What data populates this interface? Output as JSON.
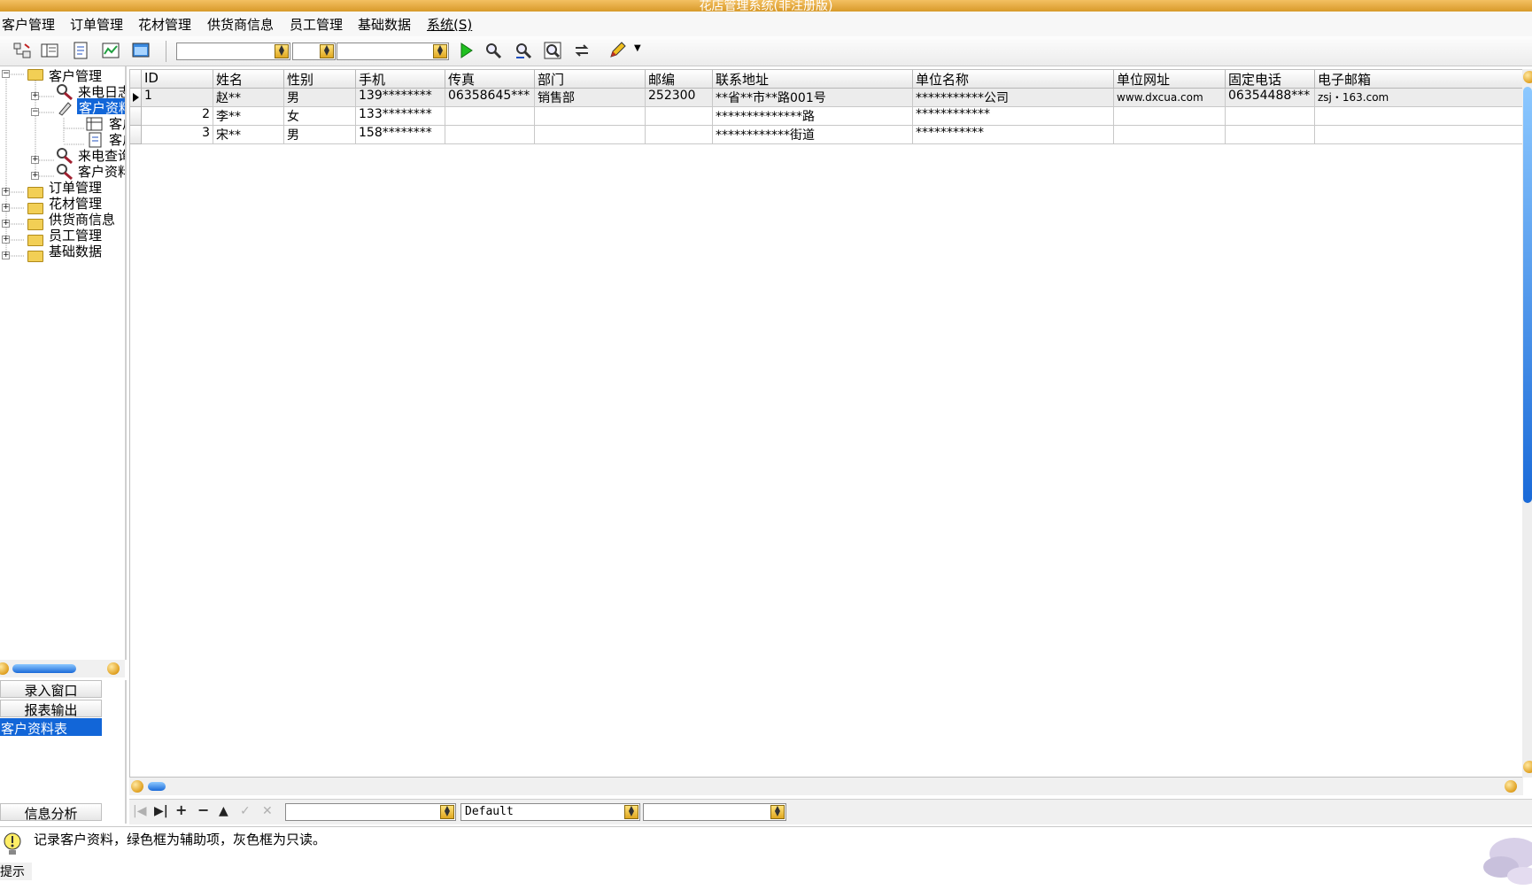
{
  "window": {
    "title": "花店管理系统(非注册版)"
  },
  "menu": [
    {
      "label": "客户管理"
    },
    {
      "label": "订单管理"
    },
    {
      "label": "花材管理"
    },
    {
      "label": "供货商信息"
    },
    {
      "label": "员工管理"
    },
    {
      "label": "基础数据"
    },
    {
      "label": "系统(S)"
    }
  ],
  "toolbar": {
    "combo3_value": "",
    "navcombo_value": "Default"
  },
  "tree": [
    {
      "label": "客户管理"
    },
    {
      "label": "来电日志"
    },
    {
      "label": "客户资料"
    },
    {
      "label": "客户资料表"
    },
    {
      "label": "客户资料卡"
    },
    {
      "label": "来电查询"
    },
    {
      "label": "客户资料"
    },
    {
      "label": "订单管理"
    },
    {
      "label": "花材管理"
    },
    {
      "label": "供货商信息"
    },
    {
      "label": "员工管理"
    },
    {
      "label": "基础数据"
    }
  ],
  "leftnav": {
    "items": [
      {
        "label": "录入窗口"
      },
      {
        "label": "报表输出"
      },
      {
        "label": "客户资料表"
      }
    ],
    "bottom": "信息分析"
  },
  "grid": {
    "columns": [
      "ID",
      "姓名",
      "性别",
      "手机",
      "传真",
      "部门",
      "邮编",
      "联系地址",
      "单位名称",
      "单位网址",
      "固定电话",
      "电子邮箱"
    ],
    "rows": [
      [
        "1",
        "赵**",
        "男",
        "139********",
        "06358645***",
        "销售部",
        "252300",
        "**省**市**路001号",
        "***********公司",
        "www.dxcua.com",
        "06354488***",
        "zsj・163.com"
      ],
      [
        "2",
        "李**",
        "女",
        "133********",
        "",
        "",
        "",
        "**************路",
        "************",
        "",
        "",
        ""
      ],
      [
        "3",
        "宋**",
        "男",
        "158********",
        "",
        "",
        "",
        "************街道",
        "***********",
        "",
        "",
        ""
      ]
    ]
  },
  "status": {
    "message": "记录客户资料，绿色框为辅助项，灰色框为只读。",
    "label": "提示"
  },
  "colors": {
    "title_bar": "#e0a632",
    "selection": "#1266d8"
  },
  "icons": [
    "tree-icon",
    "form-icon",
    "report-icon",
    "chart-icon",
    "window-icon",
    "run-icon",
    "find-icon",
    "filter-icon",
    "zoom-icon",
    "refresh-icon",
    "edit-icon"
  ]
}
